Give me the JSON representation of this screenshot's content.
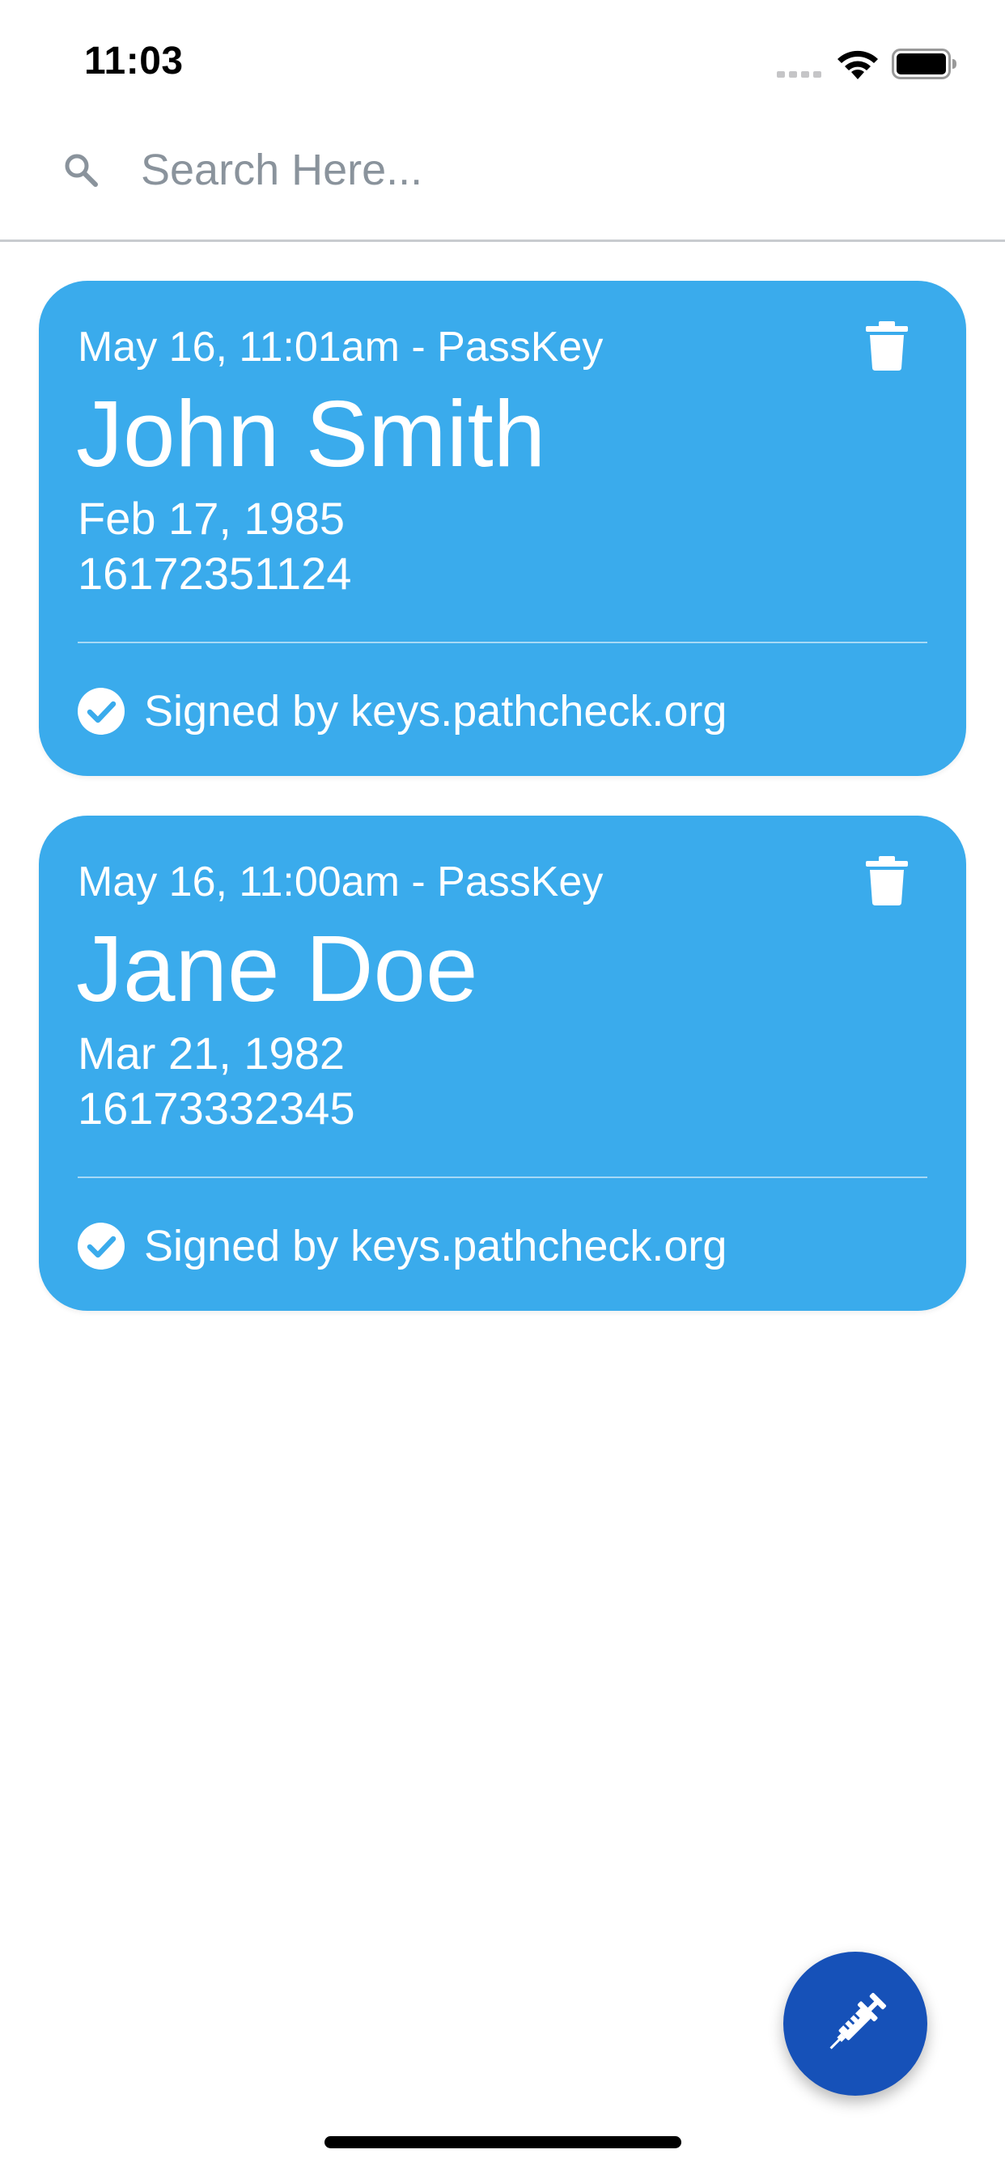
{
  "status_bar": {
    "time": "11:03"
  },
  "search": {
    "placeholder": "Search Here...",
    "value": ""
  },
  "cards": [
    {
      "meta": "May 16, 11:01am - PassKey",
      "name": "John Smith",
      "dob": "Feb 17, 1985",
      "phone": "16172351124",
      "signed": "Signed by keys.pathcheck.org"
    },
    {
      "meta": "May 16, 11:00am - PassKey",
      "name": "Jane Doe",
      "dob": "Mar 21, 1982",
      "phone": "16173332345",
      "signed": "Signed by keys.pathcheck.org"
    }
  ],
  "icons": {
    "search": "search-icon",
    "delete": "trash-icon",
    "verified": "check-circle-icon",
    "fab": "syringe-icon",
    "wifi": "wifi-icon",
    "battery": "battery-icon"
  },
  "colors": {
    "card_background": "#3aabec",
    "card_text": "#ffffff",
    "fab_background": "#1651b8",
    "placeholder_text": "#8a939c",
    "divider": "#c8cbcf"
  }
}
